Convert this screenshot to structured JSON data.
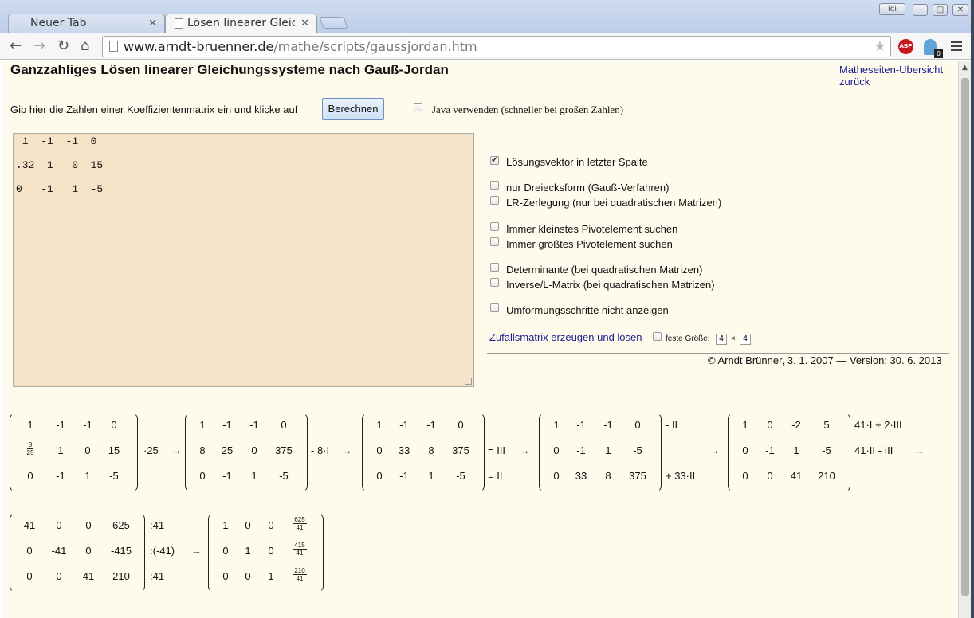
{
  "browser": {
    "tabs": [
      {
        "title": "Neuer Tab"
      },
      {
        "title": "Lösen linearer Gleic"
      }
    ],
    "window_btn_label": "ici",
    "url_domain": "www.arndt-bruenner.de",
    "url_path": "/mathe/scripts/gaussjordan.htm",
    "abp_label": "ABP",
    "ghost_badge": "0"
  },
  "page": {
    "title": "Ganzzahliges Lösen linearer Gleichungssysteme nach Gauß-Jordan",
    "link_overview": "Matheseiten-Übersicht",
    "link_back": "zurück",
    "intro": "Gib hier die Zahlen einer Koeffizientenmatrix ein und klicke auf",
    "calc_button": "Berechnen",
    "java_label": "Java verwenden (schneller bei großen Zahlen)",
    "matrix_input_lines": [
      " 1  -1  -1  0",
      ".32  1   0  15",
      "0   -1   1  -5"
    ],
    "options": [
      {
        "label": "Lösungsvektor in letzter Spalte",
        "checked": true
      },
      {
        "label": "nur Dreiecksform (Gauß-Verfahren)",
        "checked": false
      },
      {
        "label": "LR-Zerlegung (nur bei quadratischen Matrizen)",
        "checked": false
      },
      {
        "label": "Immer kleinstes Pivotelement suchen",
        "checked": false
      },
      {
        "label": "Immer größtes Pivotelement suchen",
        "checked": false
      },
      {
        "label": "Determinante (bei quadratischen Matrizen)",
        "checked": false
      },
      {
        "label": "Inverse/L-Matrix (bei quadratischen Matrizen)",
        "checked": false
      },
      {
        "label": "Umformungsschritte nicht anzeigen",
        "checked": false
      }
    ],
    "random_link": "Zufallsmatrix erzeugen und lösen",
    "fixed_size_label": "feste Größe:",
    "size_rows": "4",
    "size_times": "×",
    "size_cols": "4",
    "copyright": "© Arndt Brünner, 3. 1. 2007 — Version: 30. 6. 2013",
    "arrow": "→"
  },
  "steps": [
    {
      "rows": [
        [
          "1",
          "-1",
          "-1",
          "0"
        ],
        [
          "8/25",
          "1",
          "0",
          "15"
        ],
        [
          "0",
          "-1",
          "1",
          "-5"
        ]
      ],
      "ann": [
        "",
        "·25",
        ""
      ]
    },
    {
      "rows": [
        [
          "1",
          "-1",
          "-1",
          "0"
        ],
        [
          "8",
          "25",
          "0",
          "375"
        ],
        [
          "0",
          "-1",
          "1",
          "-5"
        ]
      ],
      "ann": [
        "",
        "- 8·I",
        ""
      ]
    },
    {
      "rows": [
        [
          "1",
          "-1",
          "-1",
          "0"
        ],
        [
          "0",
          "33",
          "8",
          "375"
        ],
        [
          "0",
          "-1",
          "1",
          "-5"
        ]
      ],
      "ann": [
        "",
        "= III",
        "= II"
      ]
    },
    {
      "rows": [
        [
          "1",
          "-1",
          "-1",
          "0"
        ],
        [
          "0",
          "-1",
          "1",
          "-5"
        ],
        [
          "0",
          "33",
          "8",
          "375"
        ]
      ],
      "ann": [
        "- II",
        "",
        "+ 33·II"
      ]
    },
    {
      "rows": [
        [
          "1",
          "0",
          "-2",
          "5"
        ],
        [
          "0",
          "-1",
          "1",
          "-5"
        ],
        [
          "0",
          "0",
          "41",
          "210"
        ]
      ],
      "ann": [
        "41·I + 2·III",
        "41·II - III",
        ""
      ]
    },
    {
      "rows": [
        [
          "41",
          "0",
          "0",
          "625"
        ],
        [
          "0",
          "-41",
          "0",
          "-415"
        ],
        [
          "0",
          "0",
          "41",
          "210"
        ]
      ],
      "ann": [
        ":41",
        ":(-41)",
        ":41"
      ]
    },
    {
      "rows": [
        [
          "1",
          "0",
          "0",
          "625/41"
        ],
        [
          "0",
          "1",
          "0",
          "415/41"
        ],
        [
          "0",
          "0",
          "1",
          "210/41"
        ]
      ],
      "ann": [
        "",
        "",
        ""
      ]
    }
  ]
}
